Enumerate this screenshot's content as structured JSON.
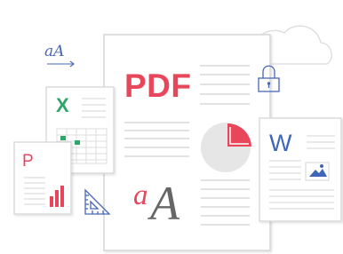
{
  "illustration": {
    "pdf_document": {
      "label": "PDF"
    },
    "spreadsheet_document": {
      "label": "X"
    },
    "presentation_document": {
      "label": "P"
    },
    "word_document": {
      "label": "W"
    },
    "font_sample": {
      "text": "aA"
    },
    "glyph_sample": {
      "lower": "a",
      "upper": "A"
    },
    "icons": [
      "cloud-icon",
      "padlock-icon",
      "pie-chart-icon",
      "bar-chart-icon",
      "image-icon",
      "drafting-triangle-icon",
      "arrow-right-icon"
    ]
  },
  "colors": {
    "red": "#e8465b",
    "green": "#2fa66a",
    "blue": "#3f66b8",
    "blue_line": "#4867b7",
    "gray_line": "#d8d8d8",
    "page_stroke": "#d5d5d5",
    "pie_gray": "#e6e6e6",
    "grid_gray": "#dedede"
  }
}
